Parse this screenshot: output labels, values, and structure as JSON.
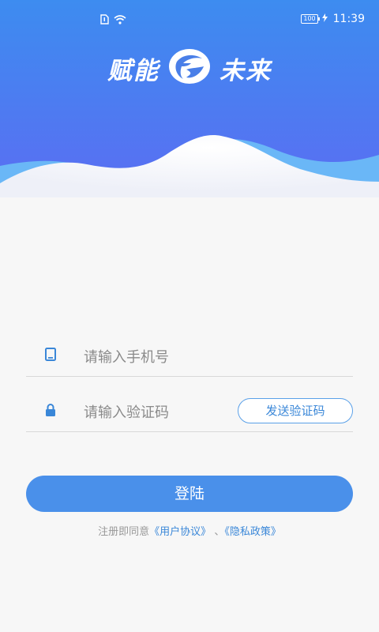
{
  "statusbar": {
    "battery": "100",
    "time": "11:39"
  },
  "brand": {
    "left": "赋能",
    "right": "未来"
  },
  "colors": {
    "header_top": "#3d8cf0",
    "header_bottom": "#5b6df2",
    "wave_back": "#6ab7f7",
    "accent": "#4a90ea"
  },
  "login": {
    "phone_placeholder": "请输入手机号",
    "code_placeholder": "请输入验证码",
    "send_code": "发送验证码",
    "submit": "登陆"
  },
  "agreement": {
    "prefix": "注册即同意",
    "user_agreement": "《用户协议》",
    "separator": "、",
    "privacy_policy": "《隐私政策》"
  },
  "icons": {
    "phone": "tablet-icon",
    "lock": "lock-icon",
    "wifi": "wifi-icon",
    "sim": "sim-icon",
    "charging": "charging-icon"
  }
}
